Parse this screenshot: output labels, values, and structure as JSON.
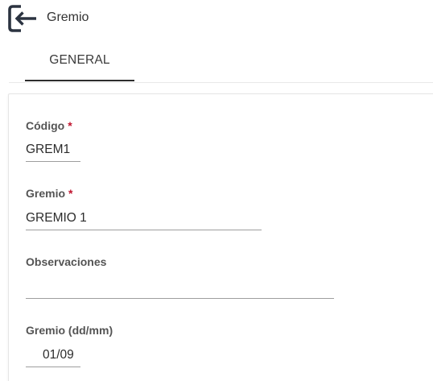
{
  "header": {
    "back_icon": "exit-to-left-icon",
    "title": "Gremio"
  },
  "tabs": [
    {
      "label": "GENERAL",
      "active": true
    }
  ],
  "form": {
    "codigo": {
      "label": "Código",
      "required_mark": "*",
      "value": "GREM1"
    },
    "gremio": {
      "label": "Gremio",
      "required_mark": "*",
      "value": "GREMIO 1"
    },
    "observaciones": {
      "label": "Observaciones",
      "value": ""
    },
    "fecha": {
      "label": "Gremio (dd/mm)",
      "value": "01/09"
    }
  },
  "colors": {
    "required": "#c0152f",
    "back_icon": "#2b3340",
    "tab_indicator": "#2d2d2d"
  }
}
